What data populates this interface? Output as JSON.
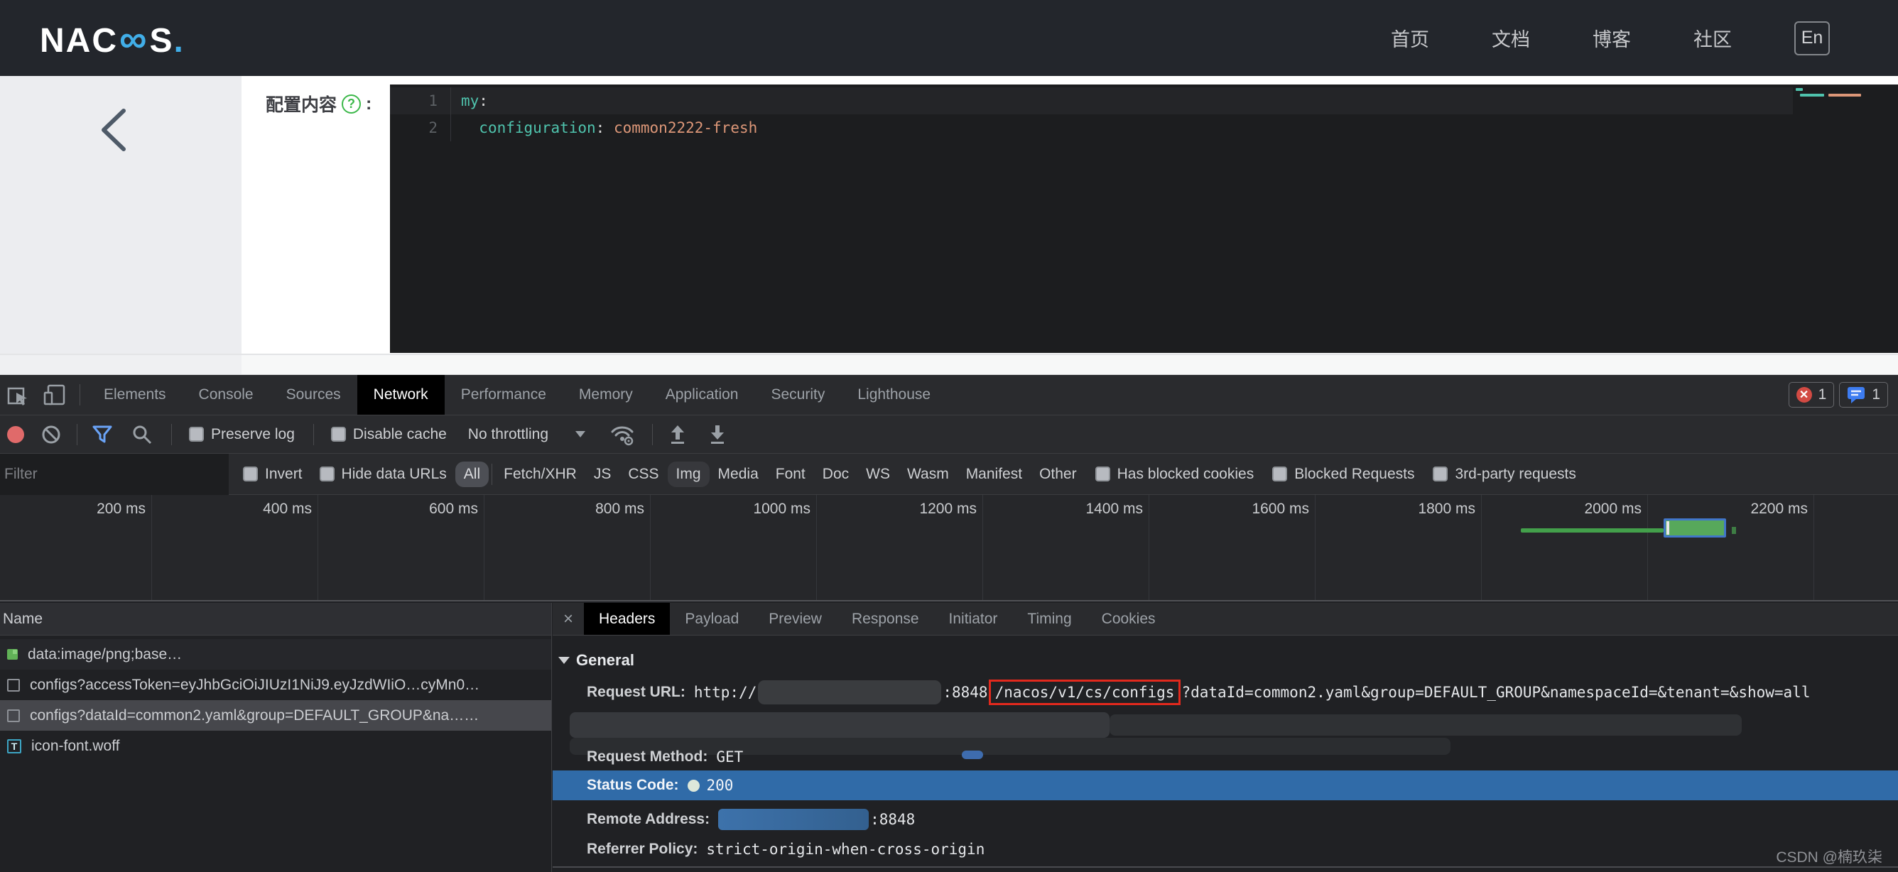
{
  "header": {
    "logo_nac": "NAC",
    "logo_infinity": "∞",
    "logo_s": "S",
    "logo_dot": ".",
    "nav": [
      "首页",
      "文档",
      "博客",
      "社区"
    ],
    "lang_button": "En"
  },
  "page": {
    "config_label": "配置内容",
    "help_icon": "?",
    "label_colon": ":",
    "editor": {
      "line1_num": "1",
      "line1_key": "my",
      "line1_colon": ":",
      "line2_num": "2",
      "line2_indent": "  ",
      "line2_key": "configuration",
      "line2_colon": ": ",
      "line2_value": "common2222-fresh"
    }
  },
  "devtools": {
    "tabs": [
      "Elements",
      "Console",
      "Sources",
      "Network",
      "Performance",
      "Memory",
      "Application",
      "Security",
      "Lighthouse"
    ],
    "active_tab": "Network",
    "error_count": "1",
    "message_count": "1",
    "toolbar": {
      "preserve_log": "Preserve log",
      "disable_cache": "Disable cache",
      "throttling": "No throttling"
    },
    "filterbar": {
      "placeholder": "Filter",
      "invert": "Invert",
      "hide_data_urls": "Hide data URLs",
      "types": [
        "All",
        "Fetch/XHR",
        "JS",
        "CSS",
        "Img",
        "Media",
        "Font",
        "Doc",
        "WS",
        "Wasm",
        "Manifest",
        "Other"
      ],
      "active_type": "All",
      "has_blocked_cookies": "Has blocked cookies",
      "blocked_requests": "Blocked Requests",
      "third_party_requests": "3rd-party requests"
    },
    "timeline": {
      "labels": [
        "200 ms",
        "400 ms",
        "600 ms",
        "800 ms",
        "1000 ms",
        "1200 ms",
        "1400 ms",
        "1600 ms",
        "1800 ms",
        "2000 ms",
        "2200 ms"
      ]
    },
    "requests": {
      "name_column": "Name",
      "rows": [
        {
          "name": "data:image/png;base…"
        },
        {
          "name": "configs?accessToken=eyJhbGciOiJIUzI1NiJ9.eyJzdWIiO…cyMn0…"
        },
        {
          "name": "configs?dataId=common2.yaml&group=DEFAULT_GROUP&na……"
        },
        {
          "name": "icon-font.woff",
          "icon_letter": "T"
        }
      ]
    },
    "details": {
      "close": "×",
      "tabs": [
        "Headers",
        "Payload",
        "Preview",
        "Response",
        "Initiator",
        "Timing",
        "Cookies"
      ],
      "active_tab": "Headers",
      "general": {
        "title": "General",
        "request_url_label": "Request URL:",
        "url_scheme": "http://",
        "url_port": ":8848",
        "url_path": "/nacos/v1/cs/configs",
        "url_query": "?dataId=common2.yaml&group=DEFAULT_GROUP&namespaceId=&tenant=&show=all",
        "request_method_label": "Request Method:",
        "request_method": "GET",
        "status_code_label": "Status Code:",
        "status_code": "200",
        "remote_address_label": "Remote Address:",
        "remote_address_port": ":8848",
        "referrer_policy_label": "Referrer Policy:",
        "referrer_policy": "strict-origin-when-cross-origin"
      }
    }
  },
  "watermark": "CSDN @楠玖柒"
}
